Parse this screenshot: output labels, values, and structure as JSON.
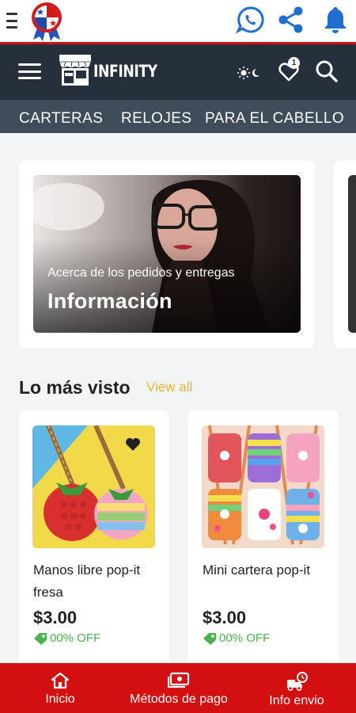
{
  "header": {
    "brand": "INFINITY",
    "cart_count": "1"
  },
  "categories": [
    "CARTERAS",
    "RELOJES",
    "PARA EL CABELLO"
  ],
  "banner": {
    "subtitle": "Acerca de los pedidos y entregas",
    "title": "Información"
  },
  "section": {
    "title": "Lo más visto",
    "view_all": "View all"
  },
  "products": [
    {
      "name": "Manos libre pop-it fresa",
      "price": "$3.00",
      "discount": "00% OFF"
    },
    {
      "name": "Mini cartera pop-it",
      "price": "$3.00",
      "discount": "00% OFF"
    }
  ],
  "bottom_nav": {
    "items": [
      {
        "label": "Inicio",
        "icon": "home-icon"
      },
      {
        "label": "Métodos de pago",
        "icon": "payment-icon"
      },
      {
        "label": "Info envio",
        "icon": "delivery-icon"
      }
    ]
  },
  "colors": {
    "header_dark": "#25303c",
    "category_bar": "#3f4c59",
    "accent_red": "#d40f0f",
    "view_all": "#f2b22c",
    "discount_green": "#4bb04e"
  }
}
